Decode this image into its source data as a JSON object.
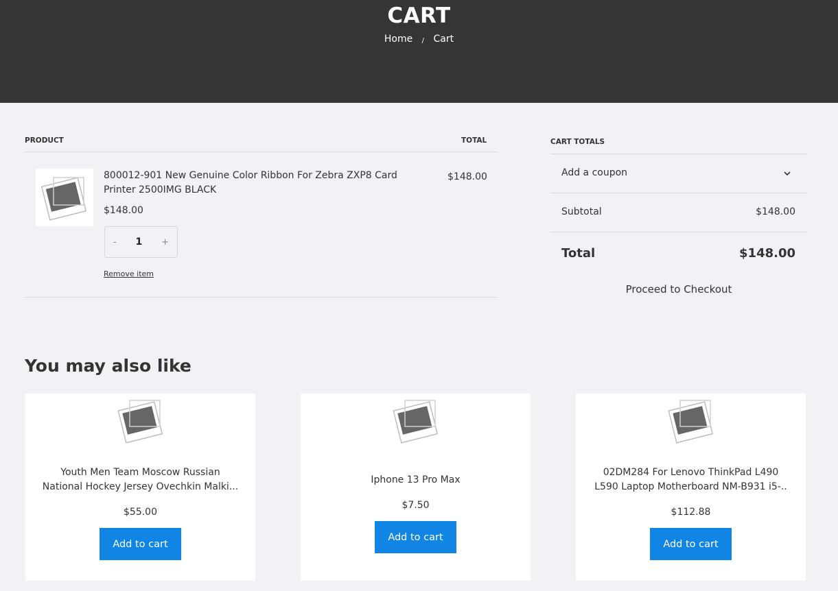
{
  "hero": {
    "title": "CART",
    "breadcrumb": {
      "home": "Home",
      "separator": "/",
      "current": "Cart"
    }
  },
  "cart_table": {
    "col_product": "PRODUCT",
    "col_total": "TOTAL",
    "items": [
      {
        "name_line1": "800012-901 New Genuine Color Ribbon For Zebra ZXP8 Card",
        "name_line2": "Printer 2500IMG BLACK",
        "price": "$148.00",
        "quantity": "1",
        "qty_minus": "-",
        "qty_plus": "+",
        "remove_label": "Remove item",
        "line_total": "$148.00",
        "image_icon": "image-placeholder-icon"
      }
    ]
  },
  "totals": {
    "title": "CART TOTALS",
    "coupon_label": "Add a coupon",
    "subtotal_label": "Subtotal",
    "subtotal_value": "$148.00",
    "total_label": "Total",
    "total_value": "$148.00",
    "checkout_label": "Proceed to Checkout"
  },
  "related": {
    "heading": "You may also like",
    "products": [
      {
        "name_line1": "Youth Men Team Moscow Russian",
        "name_line2": "National Hockey Jersey Ovechkin Malki...",
        "price": "$55.00",
        "button": "Add to cart"
      },
      {
        "name_line1": "Iphone 13 Pro Max",
        "price": "$7.50",
        "button": "Add to cart"
      },
      {
        "name_line1": "02DM284 For Lenovo ThinkPad L490",
        "name_line2": "L590 Laptop Motherboard NM-B931 i5-..",
        "price": "$112.88",
        "button": "Add to cart"
      }
    ]
  },
  "colors": {
    "hero_bg": "#353535",
    "page_bg": "#f1f2f6",
    "button_bg": "#1085e4"
  }
}
